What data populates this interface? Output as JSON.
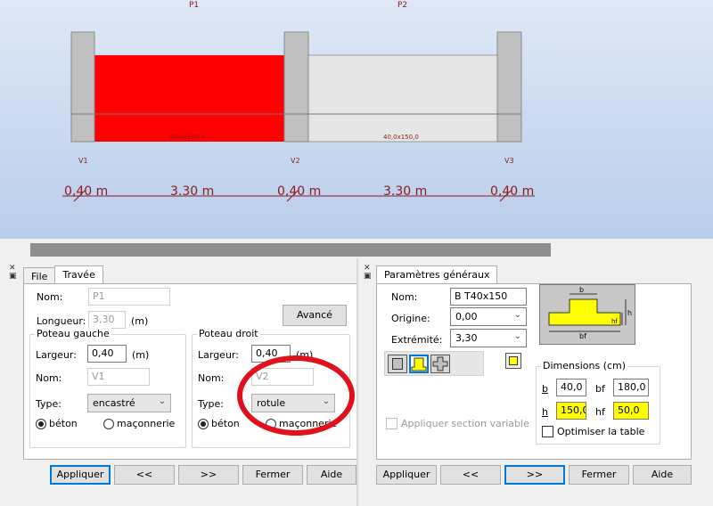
{
  "diagram": {
    "span_labels": [
      "P1",
      "P2"
    ],
    "support_labels": [
      "V1",
      "V2",
      "V3"
    ],
    "section_labels": [
      "40,0x150,0",
      "40,0x150,0"
    ],
    "dim_labels": [
      "0,40 m",
      "3.30 m",
      "0,40 m",
      "3.30 m",
      "0,40 m"
    ],
    "colors": {
      "selected_span": "#ff0000",
      "span": "#e6e6e6",
      "support": "#c0c0c0",
      "dimension": "#8b1a1a"
    }
  },
  "left_panel": {
    "tabs": [
      "File",
      "Travée"
    ],
    "active_tab": "Travée",
    "nom_label": "Nom:",
    "nom_value": "P1",
    "longueur_label": "Longueur:",
    "longueur_value": "3,30",
    "longueur_unit": "(m)",
    "avance_label": "Avancé",
    "poteau_gauche": {
      "title": "Poteau gauche",
      "largeur_label": "Largeur:",
      "largeur_value": "0,40",
      "largeur_unit": "(m)",
      "nom_label": "Nom:",
      "nom_value": "V1",
      "type_label": "Type:",
      "type_value": "encastré",
      "radio_beton": "béton",
      "radio_maconnerie": "maçonnerie"
    },
    "poteau_droit": {
      "title": "Poteau droit",
      "largeur_label": "Largeur:",
      "largeur_value": "0,40",
      "largeur_unit": "(m)",
      "nom_label": "Nom:",
      "nom_value": "V2",
      "type_label": "Type:",
      "type_value": "rotule",
      "radio_beton": "béton",
      "radio_maconnerie": "maçonnerie"
    },
    "buttons": [
      "Appliquer",
      "<<",
      ">>",
      "Fermer",
      "Aide"
    ]
  },
  "right_panel": {
    "tabs": [
      "Paramètres généraux"
    ],
    "nom_label": "Nom:",
    "nom_value": "B T40x150",
    "origine_label": "Origine:",
    "origine_value": "0,00",
    "extremite_label": "Extrémité:",
    "extremite_value": "3,30",
    "section_variable_label": "Appliquer section variable",
    "dimensions": {
      "title": "Dimensions (cm)",
      "b_label": "b",
      "b_value": "40,0",
      "bf_label": "bf",
      "bf_value": "180,0",
      "h_label": "h",
      "h_value": "150,0",
      "hf_label": "hf",
      "hf_value": "50,0",
      "optimiser_label": "Optimiser la table"
    },
    "sketch_labels": {
      "b": "b",
      "h": "h",
      "hf": "hf",
      "bf": "bf"
    },
    "buttons": [
      "Appliquer",
      "<<",
      ">>",
      "Fermer",
      "Aide"
    ]
  }
}
